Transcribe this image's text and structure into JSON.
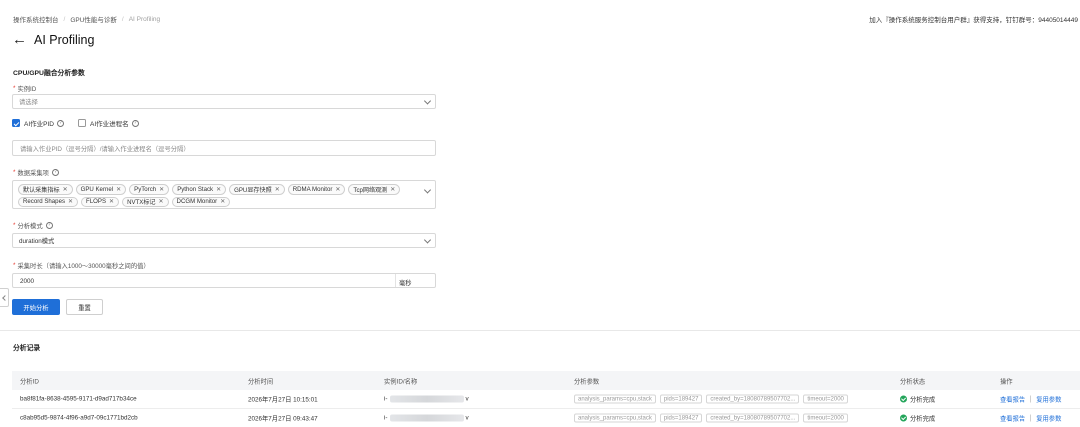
{
  "breadcrumb": {
    "items": [
      "操作系统控制台",
      "GPU性能与诊断"
    ],
    "current": "AI Profiling"
  },
  "support_text": "加入『操作系统服务控制台用户群』获得支持，钉钉群号：94405014449",
  "page": {
    "back_icon": "arrow-left-icon",
    "title": "AI Profiling"
  },
  "form": {
    "section_title": "CPU/GPU融合分析参数",
    "instance": {
      "label": "实例ID",
      "placeholder": "请选择"
    },
    "pid_mode": {
      "options": [
        {
          "label": "AI作业PID",
          "checked": true
        },
        {
          "label": "AI作业进程名",
          "checked": false
        }
      ],
      "placeholder": "请输入作业PID（逗号分隔）/请输入作业进程名（逗号分隔）"
    },
    "data_collect": {
      "label": "数据采集项",
      "tags": [
        "默认采集指标",
        "GPU Kernel",
        "PyTorch",
        "Python Stack",
        "GPU显存快照",
        "RDMA Monitor",
        "Tcp网络观测",
        "Record Shapes",
        "FLOPS",
        "NVTX标记",
        "DCGM Monitor"
      ]
    },
    "analysis_mode": {
      "label": "分析模式",
      "value": "duration模式"
    },
    "duration": {
      "label": "采集时长（请输入1000～30000毫秒之间的值）",
      "value": "2000",
      "unit": "毫秒"
    },
    "start_button": "开始分析",
    "reset_button": "重置"
  },
  "records": {
    "title": "分析记录",
    "columns": [
      "分析ID",
      "分析时间",
      "实例ID/名称",
      "分析参数",
      "分析状态",
      "操作"
    ],
    "rows": [
      {
        "id": "ba8f81fa-8638-4595-9171-d9ad717b34ce",
        "time": "2026年7月27日 10:15:01",
        "instance_prefix": "i-",
        "instance_suffix": "v",
        "params": [
          "analysis_params=cpu,stack",
          "pids=189427",
          "created_by=180807895077​02...",
          "timeout=2000"
        ],
        "status": "分析完成",
        "ops": [
          "查看报告",
          "复用参数"
        ]
      },
      {
        "id": "c8ab95d5-9874-4f96-a9d7-09c1771bd2cb",
        "time": "2026年7月27日 09:43:47",
        "instance_prefix": "i-",
        "instance_suffix": "v",
        "params": [
          "analysis_params=cpu,stack",
          "pids=189427",
          "created_by=180807895077​02...",
          "timeout=2000"
        ],
        "status": "分析完成",
        "ops": [
          "查看报告",
          "复用参数"
        ]
      }
    ]
  },
  "colors": {
    "primary": "#1f6fd8",
    "success": "#23a55a",
    "required": "#e6382e"
  }
}
